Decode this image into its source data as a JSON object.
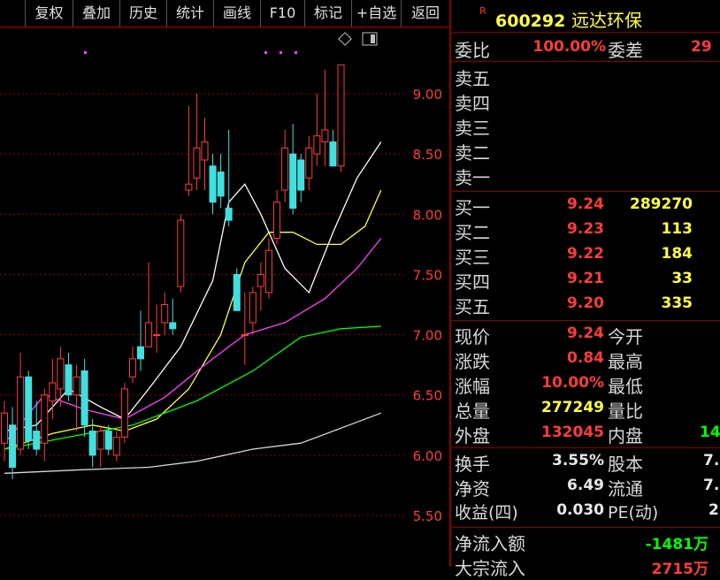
{
  "toolbar": {
    "buttons": [
      "复权",
      "叠加",
      "历史",
      "统计",
      "画线",
      "F10",
      "标记",
      "+自选",
      "返回"
    ]
  },
  "chart": {
    "price_ticks": [
      "9.00",
      "8.50",
      "8.00",
      "7.50",
      "7.00",
      "6.50",
      "6.00",
      "5.50"
    ],
    "colors": {
      "up": "#ff3c3c",
      "down": "#40e0e0",
      "ma5": "#ffffff",
      "ma10": "#ffff40",
      "ma20": "#ff40ff",
      "ma60": "#00ff00",
      "ma120": "#d8d8d8",
      "grid": "#8a0000"
    }
  },
  "chart_data": {
    "type": "candlestick",
    "ylim": [
      5.5,
      9.3
    ],
    "candles": [
      {
        "o": 6.1,
        "h": 6.45,
        "l": 5.95,
        "c": 6.35
      },
      {
        "o": 6.25,
        "h": 6.4,
        "l": 5.8,
        "c": 5.9
      },
      {
        "o": 6.05,
        "h": 6.85,
        "l": 6.0,
        "c": 6.65
      },
      {
        "o": 6.65,
        "h": 6.7,
        "l": 6.05,
        "c": 6.12
      },
      {
        "o": 6.2,
        "h": 6.45,
        "l": 6.0,
        "c": 6.05
      },
      {
        "o": 6.1,
        "h": 6.55,
        "l": 5.95,
        "c": 6.5
      },
      {
        "o": 6.45,
        "h": 6.8,
        "l": 6.3,
        "c": 6.6
      },
      {
        "o": 6.55,
        "h": 6.9,
        "l": 6.4,
        "c": 6.8
      },
      {
        "o": 6.75,
        "h": 6.85,
        "l": 6.45,
        "c": 6.5
      },
      {
        "o": 6.5,
        "h": 6.75,
        "l": 6.2,
        "c": 6.65
      },
      {
        "o": 6.7,
        "h": 6.8,
        "l": 6.15,
        "c": 6.25
      },
      {
        "o": 6.2,
        "h": 6.3,
        "l": 5.9,
        "c": 6.0
      },
      {
        "o": 6.05,
        "h": 6.25,
        "l": 5.9,
        "c": 6.2
      },
      {
        "o": 6.2,
        "h": 6.25,
        "l": 6.0,
        "c": 6.05
      },
      {
        "o": 6.0,
        "h": 6.2,
        "l": 5.95,
        "c": 6.15
      },
      {
        "o": 6.15,
        "h": 6.6,
        "l": 6.1,
        "c": 6.55
      },
      {
        "o": 6.65,
        "h": 6.9,
        "l": 6.6,
        "c": 6.8
      },
      {
        "o": 6.9,
        "h": 7.2,
        "l": 6.7,
        "c": 6.8
      },
      {
        "o": 6.9,
        "h": 7.6,
        "l": 6.9,
        "c": 7.1
      },
      {
        "o": 7.0,
        "h": 7.25,
        "l": 6.85,
        "c": 7.0
      },
      {
        "o": 7.1,
        "h": 7.35,
        "l": 7.0,
        "c": 7.25
      },
      {
        "o": 7.1,
        "h": 7.3,
        "l": 7.0,
        "c": 7.05
      },
      {
        "o": 7.4,
        "h": 8.0,
        "l": 7.35,
        "c": 7.95
      },
      {
        "o": 8.2,
        "h": 8.9,
        "l": 8.15,
        "c": 8.25
      },
      {
        "o": 8.3,
        "h": 9.0,
        "l": 8.2,
        "c": 8.55
      },
      {
        "o": 8.45,
        "h": 8.8,
        "l": 8.2,
        "c": 8.6
      },
      {
        "o": 8.4,
        "h": 8.5,
        "l": 8.0,
        "c": 8.1
      },
      {
        "o": 8.35,
        "h": 8.5,
        "l": 8.05,
        "c": 8.15
      },
      {
        "o": 8.05,
        "h": 8.7,
        "l": 7.9,
        "c": 7.95
      },
      {
        "o": 7.5,
        "h": 7.55,
        "l": 7.2,
        "c": 7.2
      },
      {
        "o": 7.0,
        "h": 7.35,
        "l": 6.75,
        "c": 7.0
      },
      {
        "o": 7.1,
        "h": 7.4,
        "l": 7.0,
        "c": 7.35
      },
      {
        "o": 7.4,
        "h": 7.6,
        "l": 7.2,
        "c": 7.5
      },
      {
        "o": 7.35,
        "h": 7.8,
        "l": 7.3,
        "c": 7.7
      },
      {
        "o": 7.8,
        "h": 8.2,
        "l": 7.75,
        "c": 8.1
      },
      {
        "o": 8.2,
        "h": 8.7,
        "l": 8.1,
        "c": 8.55
      },
      {
        "o": 8.5,
        "h": 8.75,
        "l": 8.0,
        "c": 8.05
      },
      {
        "o": 8.45,
        "h": 8.5,
        "l": 8.1,
        "c": 8.2
      },
      {
        "o": 8.3,
        "h": 8.65,
        "l": 8.2,
        "c": 8.55
      },
      {
        "o": 8.5,
        "h": 9.0,
        "l": 8.4,
        "c": 8.65
      },
      {
        "o": 8.6,
        "h": 9.2,
        "l": 8.4,
        "c": 8.7
      },
      {
        "o": 8.6,
        "h": 8.7,
        "l": 8.4,
        "c": 8.4
      },
      {
        "o": 8.4,
        "h": 9.24,
        "l": 8.35,
        "c": 9.24
      }
    ],
    "moving_averages": [
      {
        "name": "MA5",
        "color": "#ffffff",
        "points": [
          [
            0,
            6.2
          ],
          [
            4,
            6.25
          ],
          [
            8,
            6.55
          ],
          [
            12,
            6.4
          ],
          [
            15,
            6.3
          ],
          [
            18,
            6.55
          ],
          [
            22,
            6.9
          ],
          [
            26,
            7.45
          ],
          [
            28,
            8.1
          ],
          [
            30,
            8.25
          ],
          [
            32,
            8.0
          ],
          [
            35,
            7.55
          ],
          [
            38,
            7.35
          ],
          [
            41,
            7.85
          ],
          [
            44,
            8.3
          ],
          [
            47,
            8.6
          ]
        ]
      },
      {
        "name": "MA10",
        "color": "#ffff40",
        "points": [
          [
            0,
            6.05
          ],
          [
            6,
            6.18
          ],
          [
            11,
            6.25
          ],
          [
            15,
            6.2
          ],
          [
            19,
            6.3
          ],
          [
            23,
            6.55
          ],
          [
            27,
            7.0
          ],
          [
            30,
            7.6
          ],
          [
            33,
            7.85
          ],
          [
            36,
            7.85
          ],
          [
            39,
            7.75
          ],
          [
            42,
            7.75
          ],
          [
            45,
            7.9
          ],
          [
            47,
            8.2
          ]
        ]
      },
      {
        "name": "MA20",
        "color": "#ff40ff",
        "points": [
          [
            0,
            6.1
          ],
          [
            5,
            6.5
          ],
          [
            10,
            6.38
          ],
          [
            15,
            6.3
          ],
          [
            20,
            6.48
          ],
          [
            25,
            6.75
          ],
          [
            30,
            7.0
          ],
          [
            35,
            7.1
          ],
          [
            40,
            7.3
          ],
          [
            44,
            7.55
          ],
          [
            47,
            7.8
          ]
        ]
      },
      {
        "name": "MA60",
        "color": "#00ff00",
        "points": [
          [
            0,
            6.05
          ],
          [
            8,
            6.15
          ],
          [
            16,
            6.25
          ],
          [
            24,
            6.45
          ],
          [
            31,
            6.7
          ],
          [
            37,
            6.98
          ],
          [
            42,
            7.05
          ],
          [
            47,
            7.07
          ]
        ]
      },
      {
        "name": "MA120",
        "color": "#d8d8d8",
        "points": [
          [
            0,
            5.85
          ],
          [
            10,
            5.88
          ],
          [
            18,
            5.9
          ],
          [
            24,
            5.95
          ],
          [
            31,
            6.05
          ],
          [
            37,
            6.1
          ],
          [
            43,
            6.25
          ],
          [
            47,
            6.35
          ]
        ]
      }
    ]
  },
  "panel": {
    "code": "600292",
    "name": "远达环保",
    "r_mark": "R",
    "weibi_label": "委比",
    "weibi_value": "100.00%",
    "weicha_label": "委差",
    "weicha_value": "29",
    "sell_labels": [
      "卖五",
      "卖四",
      "卖三",
      "卖二",
      "卖一"
    ],
    "buy": [
      {
        "label": "买一",
        "price": "9.24",
        "vol": "289270"
      },
      {
        "label": "买二",
        "price": "9.23",
        "vol": "113"
      },
      {
        "label": "买三",
        "price": "9.22",
        "vol": "184"
      },
      {
        "label": "买四",
        "price": "9.21",
        "vol": "33"
      },
      {
        "label": "买五",
        "price": "9.20",
        "vol": "335"
      }
    ],
    "quote": [
      {
        "l1": "现价",
        "v1": "9.24",
        "c1": "red",
        "l2": "今开",
        "v2": ""
      },
      {
        "l1": "涨跌",
        "v1": "0.84",
        "c1": "red",
        "l2": "最高",
        "v2": ""
      },
      {
        "l1": "涨幅",
        "v1": "10.00%",
        "c1": "red",
        "l2": "最低",
        "v2": ""
      },
      {
        "l1": "总量",
        "v1": "277249",
        "c1": "yel",
        "l2": "量比",
        "v2": ""
      },
      {
        "l1": "外盘",
        "v1": "132045",
        "c1": "red",
        "l2": "内盘",
        "v2": "14",
        "c2": "grn"
      }
    ],
    "stats": [
      {
        "l1": "换手",
        "v1": "3.55%",
        "l2": "股本",
        "v2": "7."
      },
      {
        "l1": "净资",
        "v1": "6.49",
        "l2": "流通",
        "v2": "7."
      },
      {
        "l1": "收益(四)",
        "v1": "0.030",
        "l2": "PE(动)",
        "v2": "2"
      }
    ],
    "flow": [
      {
        "label": "净流入额",
        "value": "-1481万",
        "c": "grn"
      },
      {
        "label": "大宗流入",
        "value": "2715万",
        "c": "red"
      }
    ]
  }
}
